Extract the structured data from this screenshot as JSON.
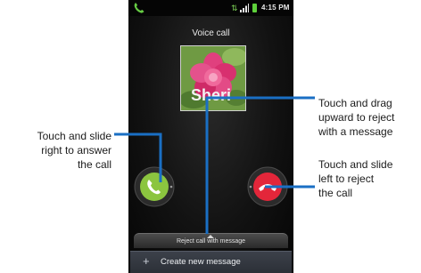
{
  "status_bar": {
    "time": "4:15 PM",
    "icons": [
      "call-in-progress-icon",
      "usb-icon",
      "signal-icon",
      "battery-icon"
    ]
  },
  "screen": {
    "title": "Voice call",
    "contact_name": "Sheri",
    "photo": "contact-photo-pink-flower"
  },
  "controls": {
    "answer_icon": "phone-answer-icon",
    "reject_icon": "phone-reject-icon",
    "reject_with_message_label": "Reject call with message",
    "create_message_label": "Create new message",
    "create_message_icon": "plus-icon"
  },
  "callouts": {
    "answer": [
      "Touch and slide",
      "right to answer",
      "the call"
    ],
    "drag": [
      "Touch and drag",
      "upward to reject",
      "with a message"
    ],
    "reject": [
      "Touch and slide",
      "left to reject",
      "the call"
    ]
  },
  "colors": {
    "leader_line": "#1a6fc4",
    "answer_green": "#8bc53f",
    "reject_red": "#e3263a"
  }
}
